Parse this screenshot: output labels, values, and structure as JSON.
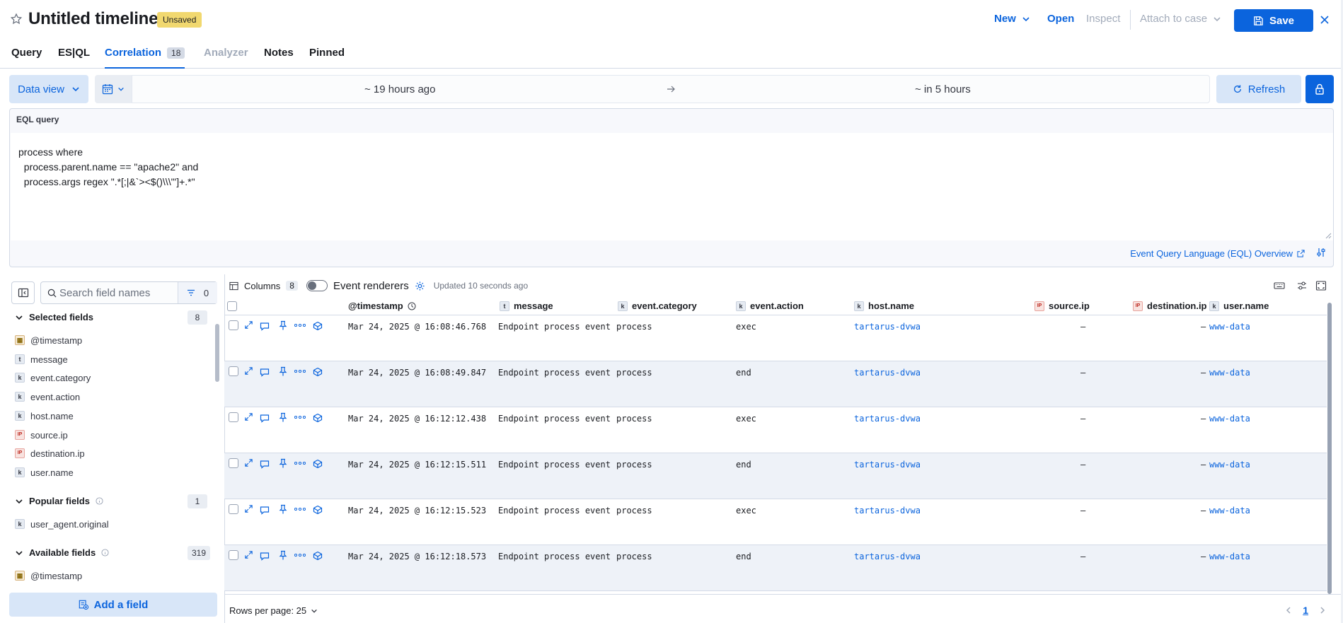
{
  "header": {
    "title": "Untitled timeline",
    "badge": "Unsaved",
    "new_label": "New",
    "open_label": "Open",
    "inspect_label": "Inspect",
    "attach_label": "Attach to case",
    "save_label": "Save"
  },
  "tabs": [
    {
      "label": "Query"
    },
    {
      "label": "ES|QL"
    },
    {
      "label": "Correlation",
      "count": "18"
    },
    {
      "label": "Analyzer"
    },
    {
      "label": "Notes"
    },
    {
      "label": "Pinned"
    }
  ],
  "datebar": {
    "data_view_label": "Data view",
    "start": "~ 19 hours ago",
    "end": "~ in 5 hours",
    "refresh_label": "Refresh"
  },
  "eql": {
    "label": "EQL query",
    "query": "process where\n  process.parent.name == \"apache2\" and\n  process.args regex \".*[;|&`><$()\\\\\\\"']+.*\"",
    "overview_link": "Event Query Language (EQL) Overview"
  },
  "fields_panel": {
    "search_placeholder": "Search field names",
    "filter_count": "0",
    "selected": {
      "label": "Selected fields",
      "count": "8",
      "items": [
        {
          "name": "@timestamp",
          "type": "date"
        },
        {
          "name": "message",
          "type": "text"
        },
        {
          "name": "event.category",
          "type": "keyword"
        },
        {
          "name": "event.action",
          "type": "keyword"
        },
        {
          "name": "host.name",
          "type": "keyword"
        },
        {
          "name": "source.ip",
          "type": "ip"
        },
        {
          "name": "destination.ip",
          "type": "ip"
        },
        {
          "name": "user.name",
          "type": "keyword"
        }
      ]
    },
    "popular": {
      "label": "Popular fields",
      "count": "1",
      "items": [
        {
          "name": "user_agent.original",
          "type": "keyword"
        }
      ]
    },
    "available": {
      "label": "Available fields",
      "count": "319",
      "items": [
        {
          "name": "@timestamp",
          "type": "date"
        }
      ]
    },
    "add_field_label": "Add a field"
  },
  "grid": {
    "columns_label": "Columns",
    "columns_count": "8",
    "renderers_label": "Event renderers",
    "updated_text": "Updated 10 seconds ago",
    "headers": [
      "@timestamp",
      "message",
      "event.category",
      "event.action",
      "host.name",
      "source.ip",
      "destination.ip",
      "user.name"
    ],
    "rows": [
      {
        "timestamp": "Mar 24, 2025 @ 16:08:46.768",
        "message": "Endpoint process event",
        "category": "process",
        "action": "exec",
        "host": "tartarus-dvwa",
        "source_ip": "—",
        "dest_ip": "—",
        "user": "www-data"
      },
      {
        "timestamp": "Mar 24, 2025 @ 16:08:49.847",
        "message": "Endpoint process event",
        "category": "process",
        "action": "end",
        "host": "tartarus-dvwa",
        "source_ip": "—",
        "dest_ip": "—",
        "user": "www-data"
      },
      {
        "timestamp": "Mar 24, 2025 @ 16:12:12.438",
        "message": "Endpoint process event",
        "category": "process",
        "action": "exec",
        "host": "tartarus-dvwa",
        "source_ip": "—",
        "dest_ip": "—",
        "user": "www-data"
      },
      {
        "timestamp": "Mar 24, 2025 @ 16:12:15.511",
        "message": "Endpoint process event",
        "category": "process",
        "action": "end",
        "host": "tartarus-dvwa",
        "source_ip": "—",
        "dest_ip": "—",
        "user": "www-data"
      },
      {
        "timestamp": "Mar 24, 2025 @ 16:12:15.523",
        "message": "Endpoint process event",
        "category": "process",
        "action": "exec",
        "host": "tartarus-dvwa",
        "source_ip": "—",
        "dest_ip": "—",
        "user": "www-data"
      },
      {
        "timestamp": "Mar 24, 2025 @ 16:12:18.573",
        "message": "Endpoint process event",
        "category": "process",
        "action": "end",
        "host": "tartarus-dvwa",
        "source_ip": "—",
        "dest_ip": "—",
        "user": "www-data"
      }
    ],
    "rows_per_page_label": "Rows per page: 25",
    "current_page": "1"
  },
  "colors": {
    "primary": "#0b64dd",
    "badge_unsaved": "#f1d86f",
    "row_alt": "#eef2f8",
    "ip_token": "#bd271e"
  },
  "icons": [
    "star-icon",
    "chevron-down-icon",
    "save-icon",
    "close-icon",
    "calendar-icon",
    "arrow-right-icon",
    "refresh-icon",
    "lock-icon",
    "external-link-icon",
    "settings-icon",
    "sidebar-toggle-icon",
    "search-icon",
    "filter-icon",
    "table-icon",
    "gear-icon",
    "clock-icon",
    "keyboard-icon",
    "sliders-icon",
    "fullscreen-icon",
    "expand-icon",
    "comment-icon",
    "pin-icon",
    "more-icon",
    "analyze-icon",
    "chevron-left-icon",
    "chevron-right-icon",
    "add-field-icon"
  ]
}
